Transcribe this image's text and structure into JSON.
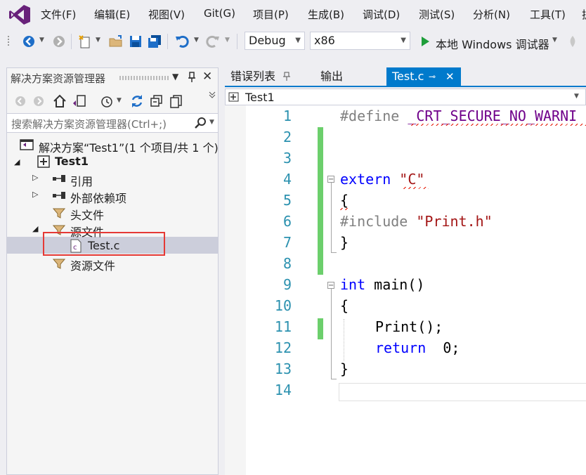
{
  "menu": [
    "文件(F)",
    "编辑(E)",
    "视图(V)",
    "Git(G)",
    "项目(P)",
    "生成(B)",
    "调试(D)",
    "测试(S)",
    "分析(N)",
    "工具(T)"
  ],
  "toolbar": {
    "config": "Debug",
    "platform": "x86",
    "run_label": "本地 Windows 调试器"
  },
  "solution_explorer": {
    "title": "解决方案资源管理器",
    "search_placeholder": "搜索解决方案资源管理器(Ctrl+;)",
    "solution_label": "解决方案“Test1”(1 个项目/共 1 个)",
    "project": "Test1",
    "nodes": [
      "引用",
      "外部依赖项",
      "头文件",
      "源文件",
      "Test.c",
      "资源文件"
    ]
  },
  "tabs": {
    "error_list": "错误列表",
    "output": "输出",
    "active": "Test.c"
  },
  "navbar": {
    "scope": "Test1"
  },
  "editor": {
    "line_numbers": [
      "1",
      "2",
      "3",
      "4",
      "5",
      "6",
      "7",
      "8",
      "9",
      "10",
      "11",
      "12",
      "13",
      "14"
    ],
    "tokens": {
      "define": "#define",
      "macro": "_CRT_SECURE_NO_WARNI",
      "extern": "extern",
      "c_str": "\"C\"",
      "brace_open": "{",
      "brace_close": "}",
      "include": "#include",
      "print_h": "\"Print.h\"",
      "int": "int",
      "main": " main()",
      "print_call": "Print();",
      "return": "return",
      "zero": "  0;"
    }
  },
  "colors": {
    "accent": "#007acc",
    "change_bar": "#6ccf6c",
    "highlight": "#e53935"
  }
}
